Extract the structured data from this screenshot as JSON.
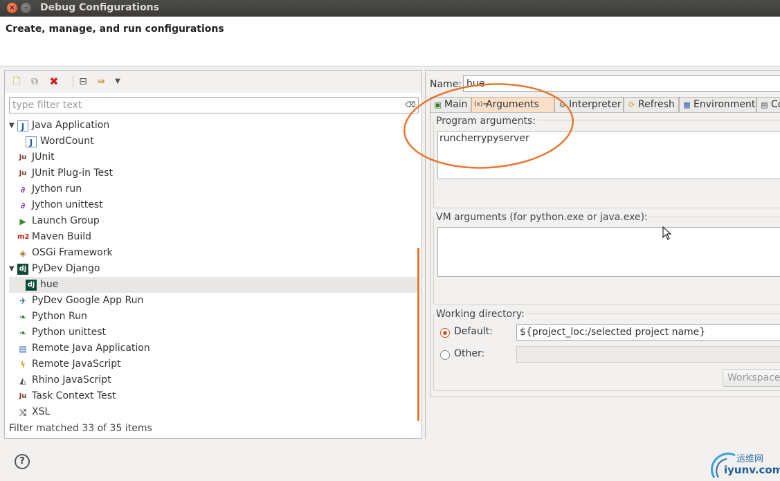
{
  "window": {
    "title": "Debug Configurations",
    "close_icon": "close-icon",
    "minimize_icon": "minimize-icon"
  },
  "header": {
    "title": "Create, manage, and run configurations"
  },
  "left": {
    "filter_placeholder": "type filter text",
    "status": "Filter matched 33 of 35 items",
    "tree": [
      {
        "label": "Java Application",
        "icon": "java-app-icon",
        "expanded": true
      },
      {
        "label": "WordCount",
        "icon": "java-app-icon",
        "child": true
      },
      {
        "label": "JUnit",
        "icon": "junit-icon"
      },
      {
        "label": "JUnit Plug-in Test",
        "icon": "junit-plugin-icon"
      },
      {
        "label": "Jython run",
        "icon": "jython-run-icon"
      },
      {
        "label": "Jython unittest",
        "icon": "jython-unittest-icon"
      },
      {
        "label": "Launch Group",
        "icon": "launch-group-icon"
      },
      {
        "label": "Maven Build",
        "icon": "maven-icon"
      },
      {
        "label": "OSGi Framework",
        "icon": "osgi-icon"
      },
      {
        "label": "PyDev Django",
        "icon": "django-icon",
        "expanded": true
      },
      {
        "label": "hue",
        "icon": "django-icon",
        "child": true,
        "selected": true
      },
      {
        "label": "PyDev Google App Run",
        "icon": "google-app-icon"
      },
      {
        "label": "Python Run",
        "icon": "python-run-icon"
      },
      {
        "label": "Python unittest",
        "icon": "python-unittest-icon"
      },
      {
        "label": "Remote Java Application",
        "icon": "remote-java-icon"
      },
      {
        "label": "Remote JavaScript",
        "icon": "remote-js-icon"
      },
      {
        "label": "Rhino JavaScript",
        "icon": "rhino-icon"
      },
      {
        "label": "Task Context Test",
        "icon": "task-context-icon"
      },
      {
        "label": "XSL",
        "icon": "xsl-icon"
      }
    ]
  },
  "right": {
    "name_label": "Name:",
    "name_value": "hue",
    "tabs": [
      {
        "label": "Main",
        "icon": "main-tab-icon"
      },
      {
        "label": "Arguments",
        "icon": "arguments-tab-icon",
        "active": true
      },
      {
        "label": "Interpreter",
        "icon": "interpreter-tab-icon"
      },
      {
        "label": "Refresh",
        "icon": "refresh-tab-icon"
      },
      {
        "label": "Environment",
        "icon": "environment-tab-icon"
      },
      {
        "label": "Co",
        "icon": "common-tab-icon"
      }
    ],
    "program_args_label": "Program arguments:",
    "program_args_value": "runcherrypyserver",
    "vm_args_label": "VM arguments (for python.exe or java.exe):",
    "vm_args_value": "",
    "working_dir_label": "Working directory:",
    "default_label": "Default:",
    "default_value": "${project_loc:/selected project name}",
    "other_label": "Other:",
    "other_value": "",
    "workspace_button": "Workspace"
  },
  "help_label": "?",
  "watermark": {
    "cn": "运维网",
    "en": "iyunv.com"
  },
  "colors": {
    "accent": "#e5561c",
    "annotation": "#e8762c",
    "active_tab": "#fbe0c9"
  }
}
